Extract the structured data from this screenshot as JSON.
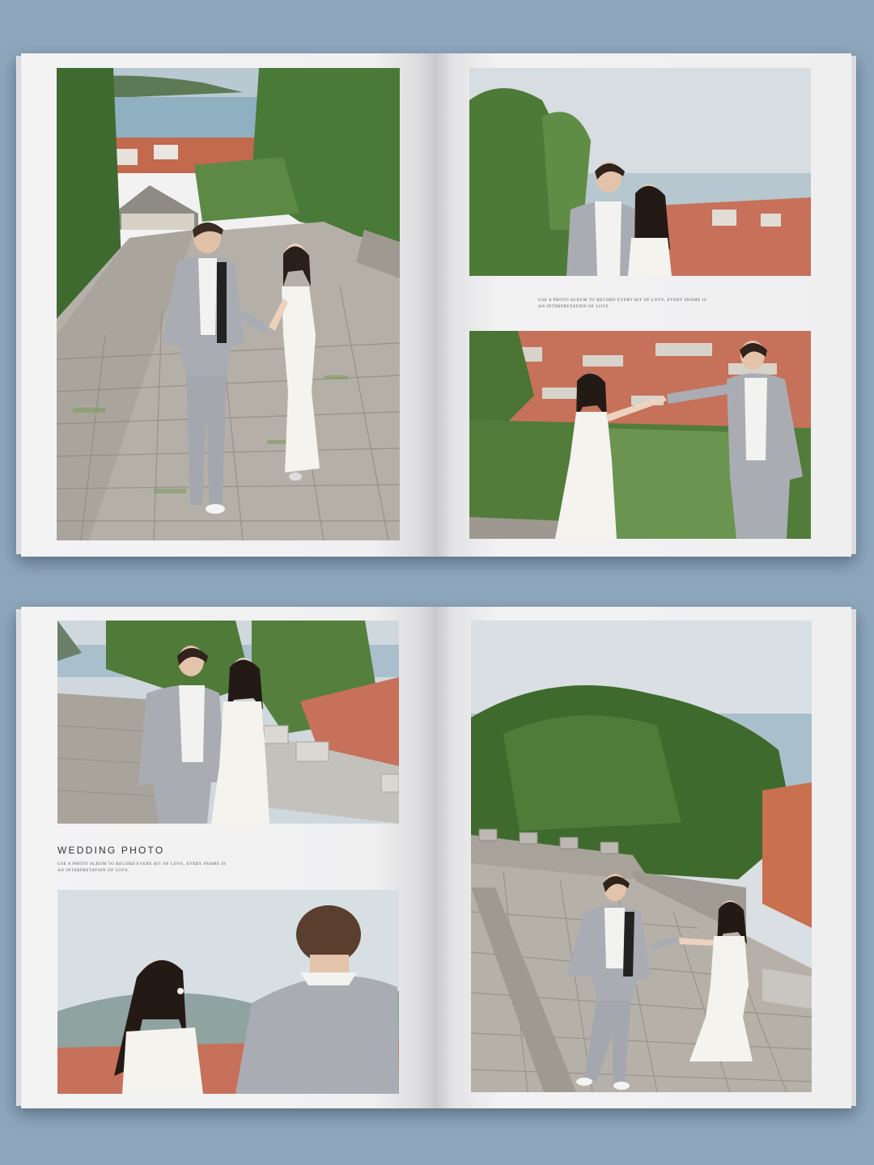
{
  "spreads": [
    {
      "caption_line1": "USE A PHOTO ALBUM TO RECORD EVERY BIT OF LOVE, EVERY FRAME IS",
      "caption_line2": "AN INTERPRETATION OF LOVE"
    },
    {
      "title": "WEDDING PHOTO",
      "caption_line1": "USE A PHOTO ALBUM TO RECORD EVERY BIT OF LOVE, EVERY FRAME IS",
      "caption_line2": "AN INTERPRETATION OF LOVE"
    }
  ],
  "colors": {
    "background": "#8ea7bd",
    "page": "#f1f1f2",
    "suit": "#a9adb3",
    "dress": "#f4f3ee",
    "foliage": "#4c7237",
    "roof": "#c8684b",
    "sea": "#9fb7c6"
  }
}
